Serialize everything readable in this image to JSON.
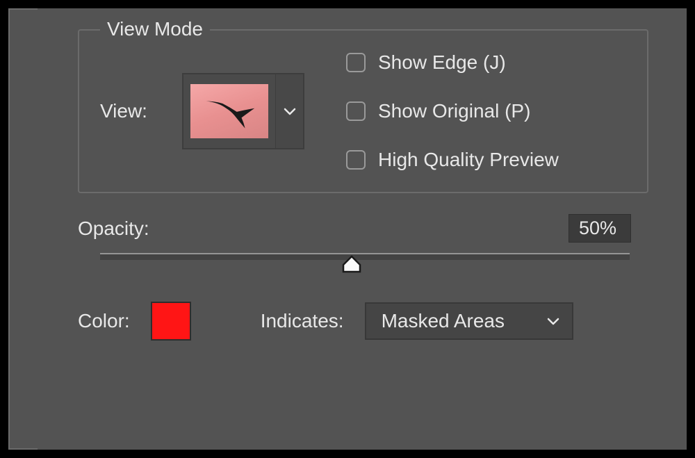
{
  "viewMode": {
    "legend": "View Mode",
    "viewLabel": "View:",
    "checkboxes": {
      "showEdge": "Show Edge (J)",
      "showOriginal": "Show Original (P)",
      "highQuality": "High Quality Preview"
    }
  },
  "opacity": {
    "label": "Opacity:",
    "value": "50%",
    "sliderPercent": 50
  },
  "color": {
    "label": "Color:",
    "value": "#ff1515"
  },
  "indicates": {
    "label": "Indicates:",
    "selected": "Masked Areas"
  }
}
